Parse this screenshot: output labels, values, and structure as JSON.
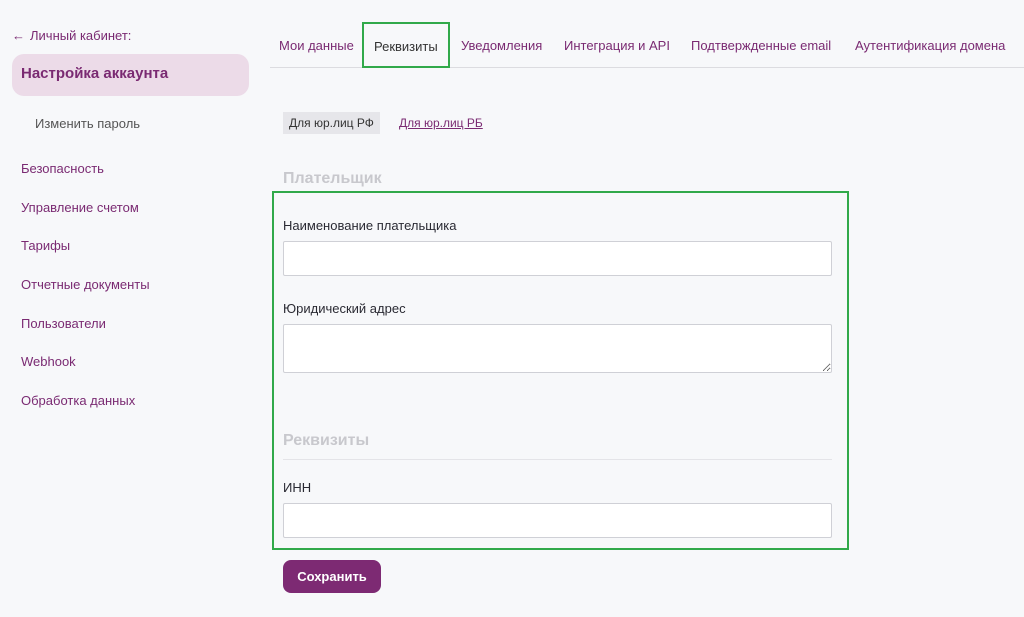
{
  "sidebar": {
    "back_label": "Личный кабинет:",
    "active_item": "Настройка аккаунта",
    "sub_item": "Изменить пароль",
    "items": [
      {
        "label": "Безопасность"
      },
      {
        "label": "Управление счетом"
      },
      {
        "label": "Тарифы"
      },
      {
        "label": "Отчетные документы"
      },
      {
        "label": "Пользователи"
      },
      {
        "label": "Webhook"
      },
      {
        "label": "Обработка данных"
      }
    ]
  },
  "tabs": [
    {
      "label": "Мои данные"
    },
    {
      "label": "Реквизиты",
      "active": true
    },
    {
      "label": "Уведомления"
    },
    {
      "label": "Интеграция и API"
    },
    {
      "label": "Подтвержденные email"
    },
    {
      "label": "Аутентификация домена"
    }
  ],
  "org_type": {
    "active": "Для юр.лиц РФ",
    "other": "Для юр.лиц РБ"
  },
  "payer_section": {
    "title": "Плательщик",
    "name_label": "Наименование плательщика",
    "name_value": "",
    "address_label": "Юридический адрес",
    "address_value": ""
  },
  "requisites_section": {
    "title": "Реквизиты",
    "inn_label": "ИНН",
    "inn_value": ""
  },
  "save_label": "Сохранить",
  "colors": {
    "accent": "#7d2a73",
    "highlight": "#31a94a",
    "active_bg": "#ecdbe8"
  },
  "icons": {
    "back": "arrow-left-icon"
  }
}
